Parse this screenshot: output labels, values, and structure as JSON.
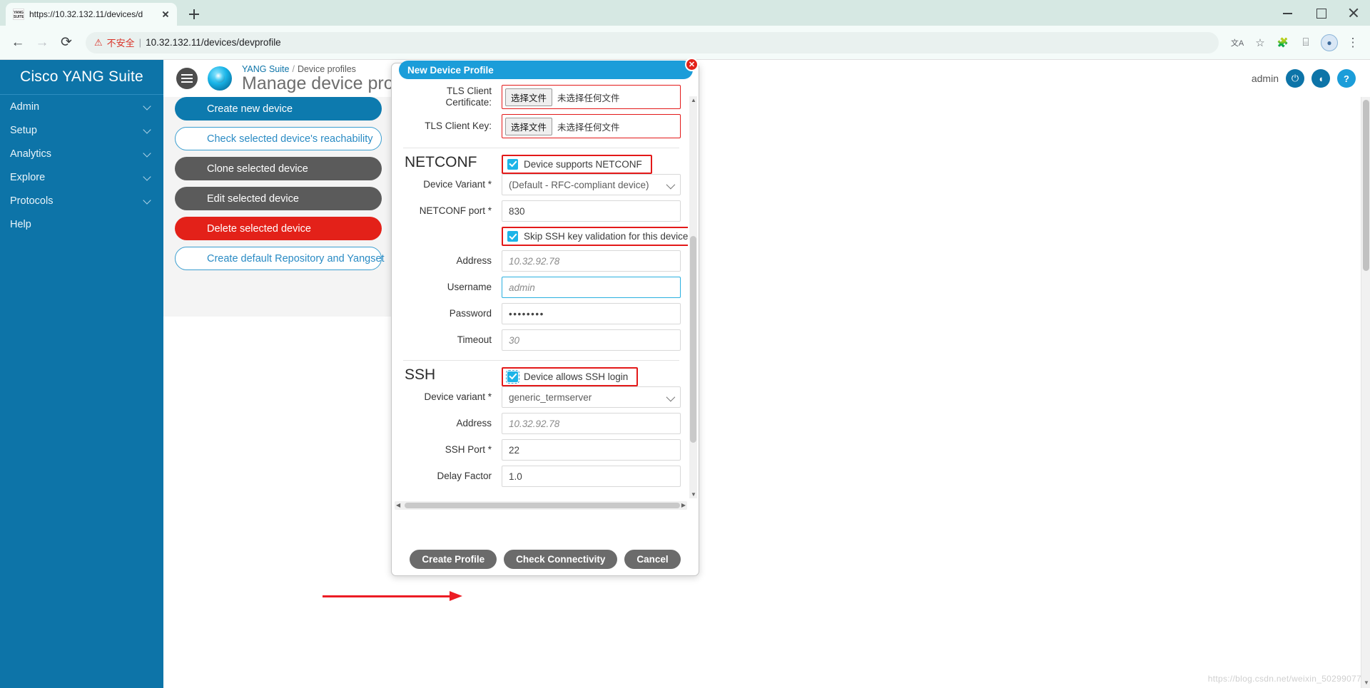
{
  "browser": {
    "tab": {
      "title": "https://10.32.132.11/devices/d",
      "favicon_text": "YANG SUITE"
    },
    "new_tab_label": "+",
    "window": {
      "minimize": "–",
      "maximize": "□",
      "close": "×"
    },
    "toolbar": {
      "back": "←",
      "forward": "→",
      "reload": "⟳",
      "warning_icon": "⚠",
      "warning_text": "不安全",
      "separator": "|",
      "url": "10.32.132.11/devices/devprofile",
      "translate_icon": "文A",
      "bookmark_icon": "☆",
      "extensions_icon": "🧩",
      "readinglist_icon": "⌸",
      "profile_initial": "●",
      "menu_icon": "⋮"
    }
  },
  "sidebar": {
    "brand": "Cisco YANG Suite",
    "items": [
      {
        "label": "Admin"
      },
      {
        "label": "Setup"
      },
      {
        "label": "Analytics"
      },
      {
        "label": "Explore"
      },
      {
        "label": "Protocols"
      },
      {
        "label": "Help"
      }
    ]
  },
  "header": {
    "breadcrumb_root": "YANG Suite",
    "breadcrumb_sep": "/",
    "breadcrumb_current": "Device profiles",
    "page_title": "Manage device profiles",
    "user": "admin",
    "logout_icon": "⏻",
    "feedback_icon": "◖",
    "help_icon": "?"
  },
  "actions": [
    {
      "label": "Create new device",
      "style": "primary"
    },
    {
      "label": "Check selected device's reachability",
      "style": "outline"
    },
    {
      "label": "Clone selected device",
      "style": "grey"
    },
    {
      "label": "Edit selected device",
      "style": "grey"
    },
    {
      "label": "Delete selected device",
      "style": "danger"
    },
    {
      "label": "Create default Repository and Yangset",
      "style": "outline"
    }
  ],
  "modal": {
    "title": "New Device Profile",
    "close_label": "✕",
    "file_picker": {
      "button": "选择文件",
      "status": "未选择任何文件"
    },
    "fields": {
      "tls_cert_label": "TLS Client Certificate:",
      "tls_key_label": "TLS Client Key:"
    },
    "netconf": {
      "section": "NETCONF",
      "supports_label": "Device supports NETCONF",
      "device_variant_label": "Device Variant *",
      "device_variant_value": "(Default - RFC-compliant device)",
      "port_label": "NETCONF port *",
      "port_value": "830",
      "skip_ssh_label": "Skip SSH key validation for this device",
      "address_label": "Address",
      "address_value": "10.32.92.78",
      "username_label": "Username",
      "username_value": "admin",
      "password_label": "Password",
      "password_value": "••••••••",
      "timeout_label": "Timeout",
      "timeout_value": "30"
    },
    "ssh": {
      "section": "SSH",
      "allows_label": "Device allows SSH login",
      "device_variant_label": "Device variant *",
      "device_variant_value": "generic_termserver",
      "address_label": "Address",
      "address_value": "10.32.92.78",
      "port_label": "SSH Port *",
      "port_value": "22",
      "delay_label": "Delay Factor",
      "delay_value": "1.0"
    },
    "footer": {
      "create": "Create Profile",
      "check": "Check Connectivity",
      "cancel": "Cancel"
    }
  },
  "watermark": "https://blog.csdn.net/weixin_50299077"
}
